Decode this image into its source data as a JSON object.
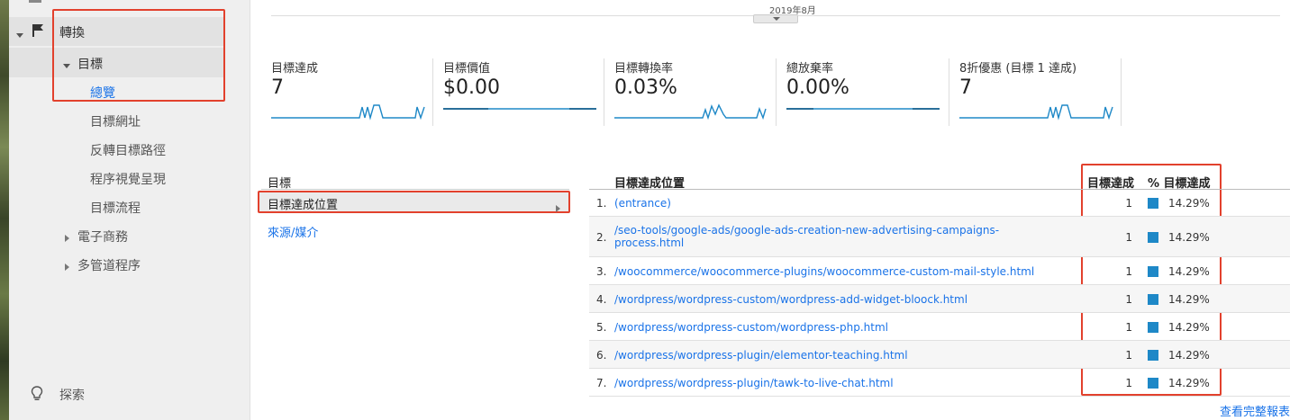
{
  "sidebar": {
    "conversions_label": "轉換",
    "goals_label": "目標",
    "items": [
      {
        "label": "總覽",
        "active": true
      },
      {
        "label": "目標網址"
      },
      {
        "label": "反轉目標路徑"
      },
      {
        "label": "程序視覺呈現"
      },
      {
        "label": "目標流程"
      }
    ],
    "ecommerce_label": "電子商務",
    "multichannel_label": "多管道程序",
    "discover_label": "探索"
  },
  "timeline": {
    "date_label": "2019年8月"
  },
  "metrics": [
    {
      "label": "目標達成",
      "value": "7"
    },
    {
      "label": "目標價值",
      "value": "$0.00"
    },
    {
      "label": "目標轉換率",
      "value": "0.03%"
    },
    {
      "label": "總放棄率",
      "value": "0.00%"
    },
    {
      "label": "8折優惠 (目標 1 達成)",
      "value": "7"
    }
  ],
  "dimension_panel": {
    "header": "目標",
    "selected": "目標達成位置",
    "other": "來源/媒介"
  },
  "table": {
    "columns": {
      "location": "目標達成位置",
      "completions": "目標達成",
      "pct": "% 目標達成"
    },
    "rows": [
      {
        "num": "1.",
        "path": "(entrance)",
        "completions": "1",
        "pct": "14.29%"
      },
      {
        "num": "2.",
        "path": "/seo-tools/google-ads/google-ads-creation-new-advertising-campaigns-process.html",
        "completions": "1",
        "pct": "14.29%"
      },
      {
        "num": "3.",
        "path": "/woocommerce/woocommerce-plugins/woocommerce-custom-mail-style.html",
        "completions": "1",
        "pct": "14.29%"
      },
      {
        "num": "4.",
        "path": "/wordpress/wordpress-custom/wordpress-add-widget-bloock.html",
        "completions": "1",
        "pct": "14.29%"
      },
      {
        "num": "5.",
        "path": "/wordpress/wordpress-custom/wordpress-php.html",
        "completions": "1",
        "pct": "14.29%"
      },
      {
        "num": "6.",
        "path": "/wordpress/wordpress-plugin/elementor-teaching.html",
        "completions": "1",
        "pct": "14.29%"
      },
      {
        "num": "7.",
        "path": "/wordpress/wordpress-plugin/tawk-to-live-chat.html",
        "completions": "1",
        "pct": "14.29%"
      }
    ],
    "full_report_label": "查看完整報表"
  },
  "colors": {
    "accent": "#1a73e8",
    "bar": "#1e88c7",
    "annotation": "#e2412d",
    "sparkline": "#1e88c7"
  }
}
